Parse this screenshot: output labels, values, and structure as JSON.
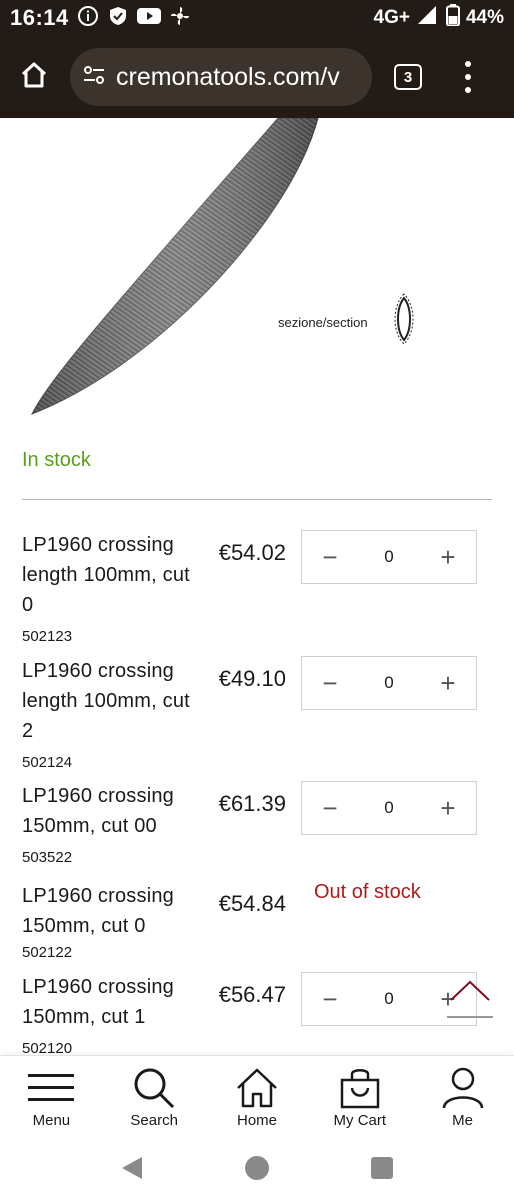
{
  "status_bar": {
    "time": "16:14",
    "network": "4G+",
    "battery": "44%",
    "icons": [
      "info-icon",
      "shield-icon",
      "youtube-icon",
      "fan-icon",
      "signal-icon",
      "battery-icon"
    ]
  },
  "browser": {
    "url": "cremonatools.com/v",
    "tab_count": "3",
    "icons": [
      "home-icon",
      "site-settings-icon",
      "tabs-icon",
      "overflow-menu-icon"
    ]
  },
  "product": {
    "section_label": "sezione/section",
    "stock_status": "In stock"
  },
  "variants": [
    {
      "name": "LP1960 crossing length 100mm, cut 0",
      "sku": "502123",
      "price": "€54.02",
      "qty": "0",
      "available": true
    },
    {
      "name": "LP1960 crossing length 100mm, cut 2",
      "sku": "502124",
      "price": "€49.10",
      "qty": "0",
      "available": true
    },
    {
      "name": "LP1960 crossing 150mm, cut 00",
      "sku": "503522",
      "price": "€61.39",
      "qty": "0",
      "available": true
    },
    {
      "name": "LP1960 crossing 150mm, cut 0",
      "sku": "502122",
      "price": "€54.84",
      "available": false,
      "status": "Out of stock"
    },
    {
      "name": "LP1960 crossing 150mm, cut 1",
      "sku": "502120",
      "price": "€56.47",
      "qty": "0",
      "available": true
    }
  ],
  "qty_controls": {
    "minus": "−",
    "plus": "+"
  },
  "bottom_nav": [
    {
      "label": "Menu",
      "icon": "hamburger-icon"
    },
    {
      "label": "Search",
      "icon": "search-icon"
    },
    {
      "label": "Home",
      "icon": "home-icon"
    },
    {
      "label": "My Cart",
      "icon": "shopping-bag-icon"
    },
    {
      "label": "Me",
      "icon": "user-icon"
    }
  ],
  "colors": {
    "in_stock": "#5a9e1c",
    "out_of_stock": "#b01a1a",
    "chrome": "#231c16",
    "back_to_top": "#7a1020"
  }
}
